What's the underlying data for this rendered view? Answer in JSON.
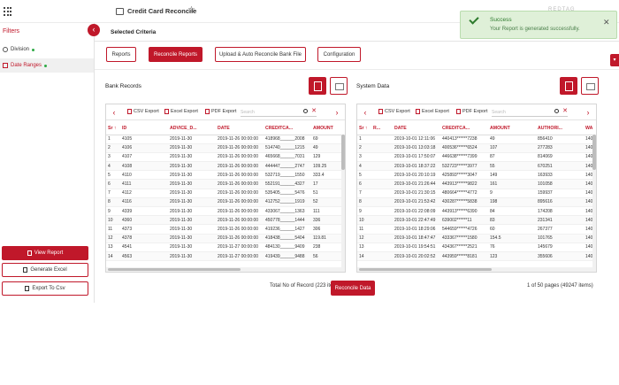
{
  "header": {
    "app_title": "Credit Card Reconcile",
    "top_right": "REDTAG"
  },
  "toast": {
    "title": "Success",
    "message": "Your Report is generated successfully.",
    "close": "✕"
  },
  "sidebar": {
    "title": "Filters",
    "collapse": "‹",
    "items": [
      {
        "label": "Division"
      },
      {
        "label": "Date Ranges"
      }
    ],
    "view_report": "View Report",
    "generate_excel": "Generate Excel",
    "export_csv": "Export To Csv"
  },
  "main": {
    "criteria_title": "Selected Criteria",
    "tabs": [
      {
        "label": "Reports"
      },
      {
        "label": "Reconcile Reports"
      },
      {
        "label": "Upload & Auto Reconcile Bank File"
      },
      {
        "label": "Configuration"
      }
    ],
    "reconcile_button": "Reconcile Data"
  },
  "bank": {
    "title": "Bank Records",
    "toolbar": {
      "prev": "‹",
      "next": "›",
      "csv": "CSV Export",
      "excel": "Excel Export",
      "pdf": "PDF Export",
      "search_placeholder": "Search",
      "clear": "✕"
    },
    "columns": [
      "Sr ↑",
      "ID",
      "ADVICE_D...",
      "DATE",
      "CREDITCA...",
      "AMOUNT"
    ],
    "rows": [
      [
        "1",
        "4105",
        "2019-11-30",
        "2019-11-26 00:00:00",
        "418968______2008",
        "69"
      ],
      [
        "2",
        "4106",
        "2019-11-30",
        "2019-11-26 00:00:00",
        "514740______1215",
        "49"
      ],
      [
        "3",
        "4107",
        "2019-11-30",
        "2019-11-26 00:00:00",
        "465668______7031",
        "129"
      ],
      [
        "4",
        "4108",
        "2019-11-30",
        "2019-11-26 00:00:00",
        "444447______2747",
        "109.25"
      ],
      [
        "5",
        "4110",
        "2019-11-30",
        "2019-11-26 00:00:00",
        "532719______1550",
        "333.4"
      ],
      [
        "6",
        "4111",
        "2019-11-30",
        "2019-11-26 00:00:00",
        "552191______4327",
        "17"
      ],
      [
        "7",
        "4112",
        "2019-11-30",
        "2019-11-26 00:00:00",
        "535405______5476",
        "51"
      ],
      [
        "8",
        "4116",
        "2019-11-30",
        "2019-11-26 00:00:00",
        "412752______1919",
        "52"
      ],
      [
        "9",
        "4339",
        "2019-11-30",
        "2019-11-26 00:00:00",
        "433067______1363",
        "111"
      ],
      [
        "10",
        "4360",
        "2019-11-30",
        "2019-11-26 00:00:00",
        "450778______1444",
        "336"
      ],
      [
        "11",
        "4373",
        "2019-11-30",
        "2019-11-26 00:00:00",
        "419236______1427",
        "306"
      ],
      [
        "12",
        "4378",
        "2019-11-30",
        "2019-11-26 00:00:00",
        "418438______5404",
        "119.81"
      ],
      [
        "13",
        "4541",
        "2019-11-30",
        "2019-11-27 00:00:00",
        "484130______9409",
        "238"
      ],
      [
        "14",
        "4563",
        "2019-11-30",
        "2019-11-27 00:00:00",
        "419439______9488",
        "56"
      ]
    ],
    "footer": "Total No of Record (223 items)"
  },
  "system": {
    "title": "System Data",
    "toolbar": {
      "prev": "‹",
      "next": "›",
      "csv": "CSV Export",
      "excel": "Excel Export",
      "pdf": "PDF Export",
      "search_placeholder": "Search",
      "clear": "✕"
    },
    "columns": [
      "Sr ↑",
      "R...",
      "DATE",
      "CREDITCA...",
      "AMOUNT",
      "AUTHORI...",
      "WA"
    ],
    "rows": [
      [
        "1",
        "",
        "2019-10-01 12:11:06",
        "440413******7238",
        "49",
        "856410",
        "140"
      ],
      [
        "2",
        "",
        "2019-10-01 13:03:18",
        "400536******6524",
        "107",
        "277283",
        "140"
      ],
      [
        "3",
        "",
        "2019-10-01 17:50:07",
        "446638******7399",
        "87",
        "814069",
        "140"
      ],
      [
        "4",
        "",
        "2019-10-01 18:37:22",
        "532723******3977",
        "55",
        "670251",
        "140"
      ],
      [
        "5",
        "",
        "2019-10-01 20:10:19",
        "425893******3047",
        "149",
        "163933",
        "140"
      ],
      [
        "6",
        "",
        "2019-10-01 21:26:44",
        "443913******9822",
        "161",
        "101058",
        "140"
      ],
      [
        "7",
        "",
        "2019-10-01 21:30:15",
        "480664******4772",
        "9",
        "159937",
        "140"
      ],
      [
        "8",
        "",
        "2019-10-01 21:53:42",
        "430287******5838",
        "198",
        "895616",
        "140"
      ],
      [
        "9",
        "",
        "2019-10-01 22:08:09",
        "443913******6390",
        "84",
        "174208",
        "140"
      ],
      [
        "10",
        "",
        "2019-10-01 22:47:49",
        "639002******11",
        "83",
        "231341",
        "140"
      ],
      [
        "11",
        "",
        "2019-10-01 18:29:06",
        "544659******4726",
        "60",
        "267377",
        "140"
      ],
      [
        "12",
        "",
        "2019-10-01 18:47:47",
        "433367******1580",
        "154.5",
        "101765",
        "140"
      ],
      [
        "13",
        "",
        "2019-10-01 19:54:51",
        "434367******2521",
        "76",
        "145679",
        "140"
      ],
      [
        "14",
        "",
        "2019-10-01 20:02:52",
        "443959******8181",
        "123",
        "355606",
        "140"
      ]
    ],
    "footer": "1 of 50 pages (49247 items)"
  }
}
